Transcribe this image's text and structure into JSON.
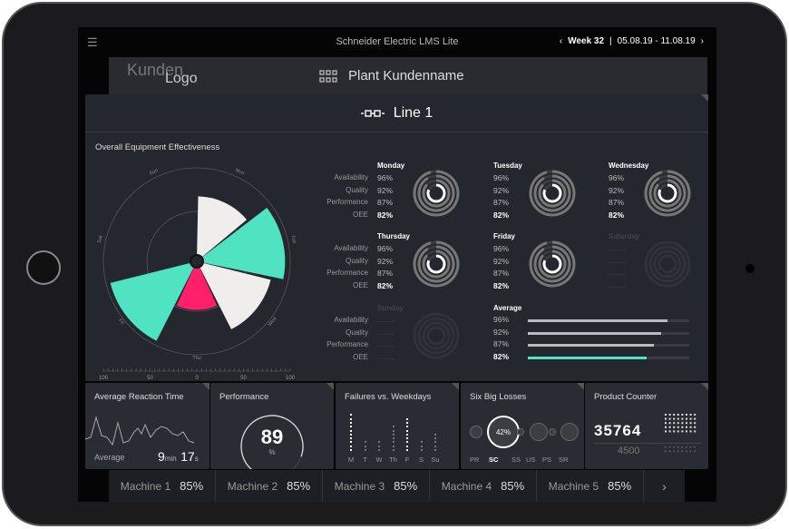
{
  "app": {
    "title": "Schneider Electric LMS Lite",
    "menu_icon": "hamburger-icon",
    "week_label": "Week 32",
    "date_range": "05.08.19 - 11.08.19",
    "prev": "‹",
    "next": "›"
  },
  "plant": {
    "logo_line1": "Kunden",
    "logo_line2": "Logo",
    "name": "Plant Kundenname",
    "icon": "plant-grid-icon"
  },
  "line": {
    "name": "Line 1",
    "icon": "line-connector-icon"
  },
  "oee": {
    "title": "Overall Equipment Effectiveness",
    "labels": [
      "Availability",
      "Quality",
      "Performance",
      "OEE"
    ],
    "days": [
      {
        "name": "Monday",
        "values": [
          "96%",
          "92%",
          "87%",
          "82%"
        ],
        "active": true
      },
      {
        "name": "Tuesday",
        "values": [
          "96%",
          "92%",
          "87%",
          "82%"
        ],
        "active": true
      },
      {
        "name": "Wednesday",
        "values": [
          "96%",
          "92%",
          "87%",
          "82%"
        ],
        "active": true
      },
      {
        "name": "Thursday",
        "values": [
          "96%",
          "92%",
          "87%",
          "82%"
        ],
        "active": true
      },
      {
        "name": "Friday",
        "values": [
          "96%",
          "92%",
          "87%",
          "82%"
        ],
        "active": true
      },
      {
        "name": "Saturday",
        "values": [],
        "active": false
      },
      {
        "name": "Sunday",
        "values": [],
        "active": false
      }
    ],
    "average": {
      "title": "Average",
      "values": [
        "96%",
        "92%",
        "87%",
        "82%"
      ],
      "fractions": [
        0.96,
        0.92,
        0.87,
        0.82
      ]
    },
    "colors": {
      "accent": "#4fe3c1",
      "highlight": "#ff1f6b",
      "light": "#f0eeec"
    }
  },
  "chart_data": {
    "type": "polar-bar",
    "categories": [
      "Mon",
      "Tue",
      "Wed",
      "Thu",
      "Fri",
      "Sat",
      "Sun"
    ],
    "values": [
      67,
      94,
      80,
      48,
      95,
      0,
      0
    ],
    "colors": [
      "#f0eeec",
      "#4fe3c1",
      "#f0eeec",
      "#ff1f6b",
      "#4fe3c1",
      "",
      ""
    ],
    "rlim": [
      0,
      100
    ],
    "scale_ticks": [
      "100",
      "50",
      "0",
      "50",
      "100"
    ]
  },
  "cards": {
    "reaction": {
      "title": "Average Reaction Time",
      "avg_label": "Average",
      "min": "9",
      "min_unit": "min",
      "sec": "17",
      "sec_unit": "s"
    },
    "performance": {
      "title": "Performance",
      "value": "89",
      "unit": "%",
      "fraction": 0.89
    },
    "failures": {
      "title": "Failures vs. Weekdays",
      "days": [
        "M",
        "T",
        "W",
        "Th",
        "F",
        "S",
        "Su"
      ],
      "counts": [
        10,
        3,
        3,
        7,
        9,
        3,
        5
      ],
      "highlight": [
        true,
        false,
        false,
        false,
        true,
        false,
        false
      ]
    },
    "losses": {
      "title": "Six Big Losses",
      "items": [
        "PR",
        "SC",
        "SS",
        "US",
        "PS",
        "SR"
      ],
      "selected": "SC",
      "selected_value": "42%"
    },
    "counter": {
      "title": "Product Counter",
      "value": "35764",
      "target": "4500"
    }
  },
  "machines": [
    {
      "name": "Machine 1",
      "value": "85%"
    },
    {
      "name": "Machine 2",
      "value": "85%"
    },
    {
      "name": "Machine 3",
      "value": "85%"
    },
    {
      "name": "Machine 4",
      "value": "85%"
    },
    {
      "name": "Machine 5",
      "value": "85%"
    }
  ],
  "machines_next": "›"
}
